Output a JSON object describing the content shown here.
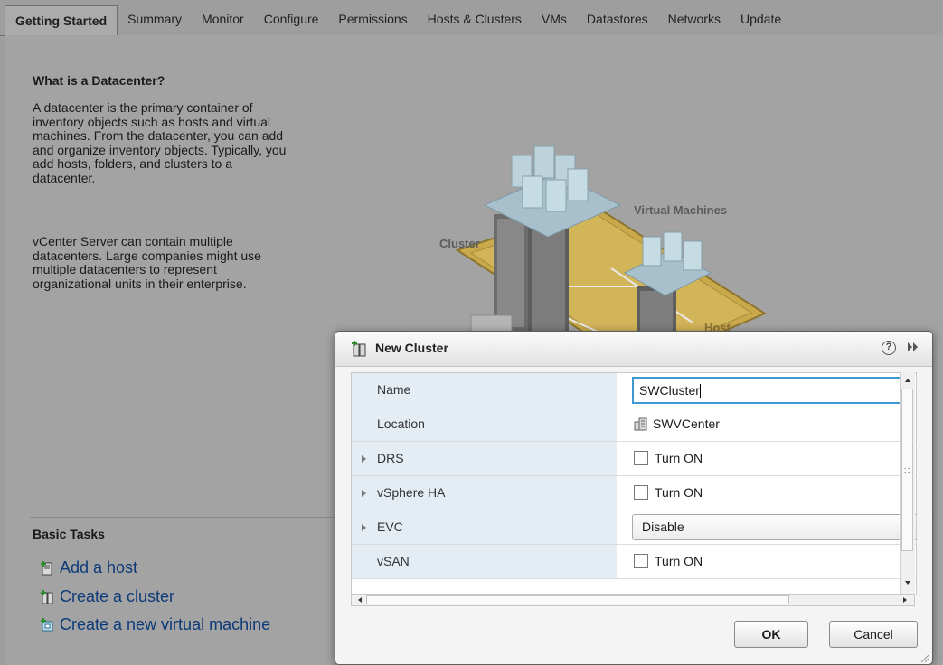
{
  "tabs": [
    "Getting Started",
    "Summary",
    "Monitor",
    "Configure",
    "Permissions",
    "Hosts & Clusters",
    "VMs",
    "Datastores",
    "Networks",
    "Update"
  ],
  "getting_started": {
    "title": "What is a Datacenter?",
    "paragraph1": "A datacenter is the primary container of\ninventory objects such as hosts and virtual\nmachines. From the datacenter, you can add\nand organize inventory objects. Typically, you\nadd hosts, folders, and clusters to a\ndatacenter.",
    "paragraph2": "vCenter Server can contain multiple\ndatacenters. Large companies might use\nmultiple datacenters to represent\norganizational units in their enterprise."
  },
  "illustration": {
    "cluster_label": "Cluster",
    "vm_label": "Virtual Machines",
    "host_label": "Host"
  },
  "basic_tasks": {
    "title": "Basic Tasks",
    "items": [
      "Add a host",
      "Create a cluster",
      "Create a new virtual machine"
    ]
  },
  "dialog": {
    "title": "New Cluster",
    "help_glyph": "?",
    "fields": {
      "name_label": "Name",
      "name_value": "SWCluster",
      "location_label": "Location",
      "location_value": "SWVCenter",
      "drs_label": "DRS",
      "drs_value": "Turn ON",
      "ha_label": "vSphere HA",
      "ha_value": "Turn ON",
      "evc_label": "EVC",
      "evc_value": "Disable",
      "vsan_label": "vSAN",
      "vsan_value": "Turn ON"
    },
    "ok_label": "OK",
    "cancel_label": "Cancel"
  },
  "colors": {
    "accent": "#3d9ad1",
    "link": "#0d3a78",
    "overlay_bg": "#9e9e9e",
    "cluster_fill": "#c9a94a"
  }
}
